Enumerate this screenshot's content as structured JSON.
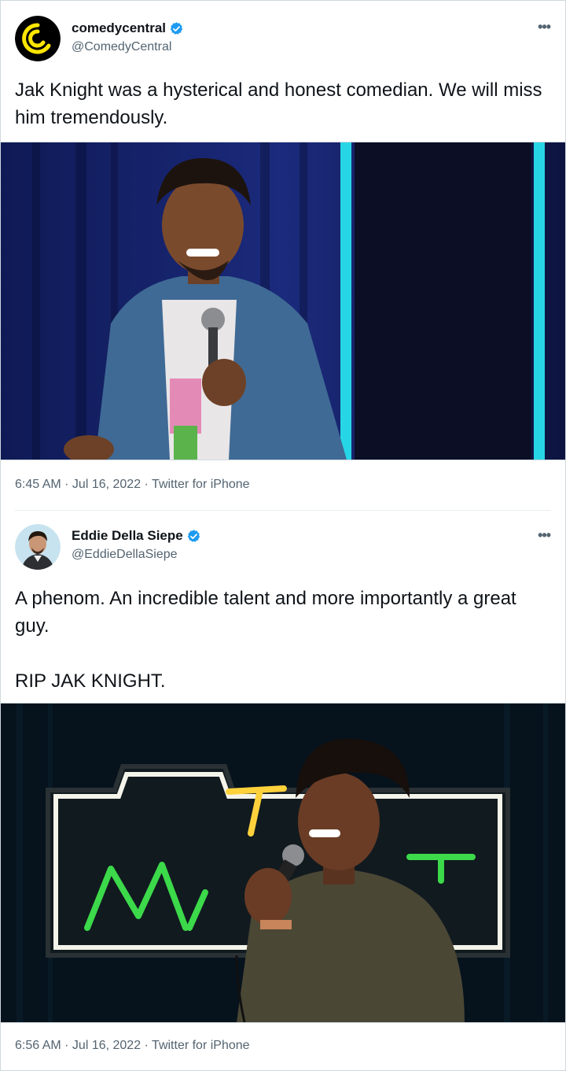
{
  "tweets": [
    {
      "display_name": "comedycentral",
      "handle": "@ComedyCentral",
      "verified": true,
      "text": "Jak Knight was a hysterical and honest comedian. We will miss him tremendously.",
      "time": "6:45 AM",
      "date": "Jul 16, 2022",
      "source": "Twitter for iPhone",
      "more_icon": "more-horizontal-icon",
      "avatar_icon": "comedy-central-logo",
      "brand_color": "#ffe600"
    },
    {
      "display_name": "Eddie Della Siepe",
      "handle": "@EddieDellaSiepe",
      "verified": true,
      "text": "A phenom. An incredible talent and more importantly a great guy.\n\nRIP JAK KNIGHT.",
      "time": "6:56 AM",
      "date": "Jul 16, 2022",
      "source": "Twitter for iPhone",
      "more_icon": "more-horizontal-icon",
      "avatar_icon": "profile-photo"
    }
  ],
  "separator": " · ",
  "colors": {
    "verified_blue": "#1d9bf0",
    "secondary_text": "#536471",
    "neon_cyan": "#27d6e6",
    "neon_green": "#3cd94a",
    "neon_yellow": "#ffd23c"
  }
}
